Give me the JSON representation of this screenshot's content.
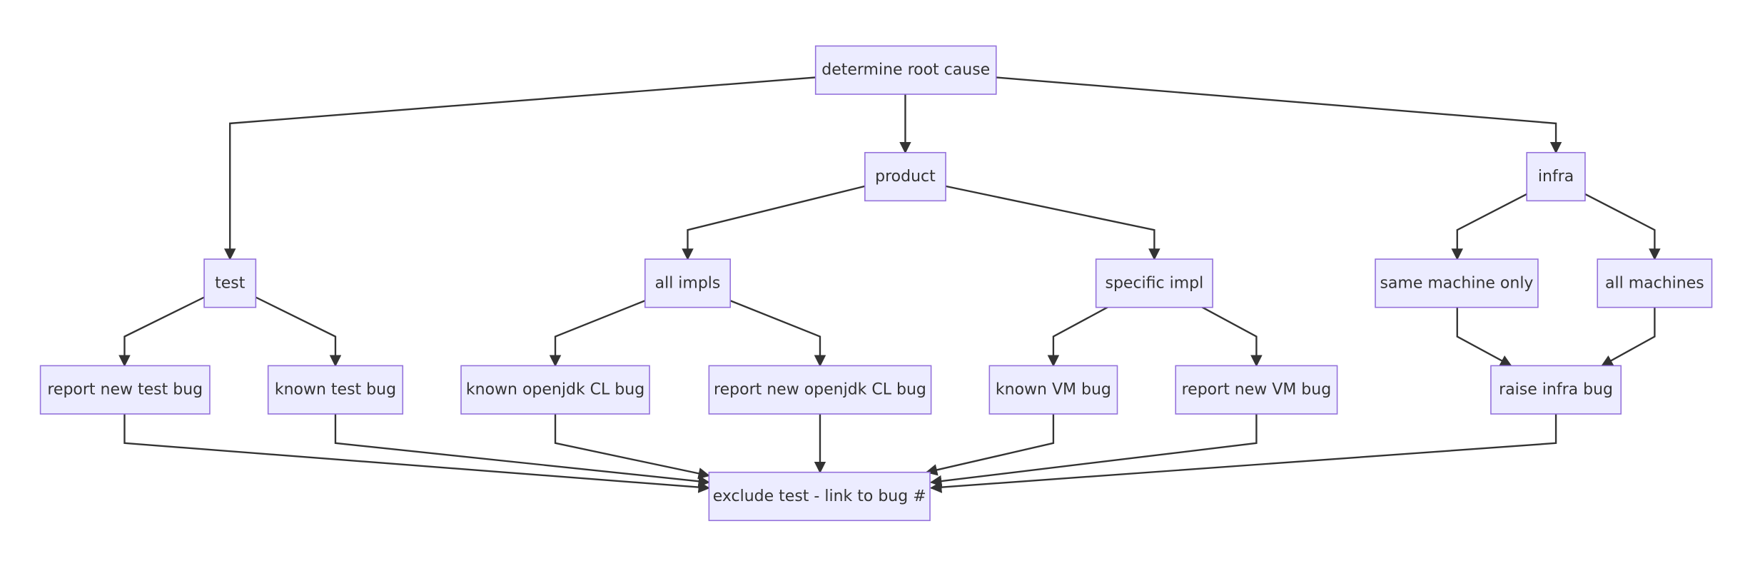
{
  "diagram": {
    "type": "flowchart",
    "direction": "top-down",
    "colors": {
      "node_fill": "#ECECFF",
      "node_border": "#9370DB",
      "edge": "#333333",
      "text": "#333333"
    },
    "nodes": {
      "root": "determine root cause",
      "test": "test",
      "product": "product",
      "infra": "infra",
      "all_impls": "all impls",
      "specific_impl": "specific impl",
      "same_machine": "same machine only",
      "all_machines": "all machines",
      "report_test_bug": "report new test bug",
      "known_test_bug": "known test bug",
      "known_openjdk": "known openjdk CL bug",
      "report_openjdk": "report new openjdk CL bug",
      "known_vm": "known VM bug",
      "report_vm": "report new VM bug",
      "raise_infra": "raise infra bug",
      "exclude": "exclude test - link to bug #"
    },
    "edges": [
      [
        "root",
        "test"
      ],
      [
        "root",
        "product"
      ],
      [
        "root",
        "infra"
      ],
      [
        "product",
        "all_impls"
      ],
      [
        "product",
        "specific_impl"
      ],
      [
        "infra",
        "same_machine"
      ],
      [
        "infra",
        "all_machines"
      ],
      [
        "test",
        "report_test_bug"
      ],
      [
        "test",
        "known_test_bug"
      ],
      [
        "all_impls",
        "known_openjdk"
      ],
      [
        "all_impls",
        "report_openjdk"
      ],
      [
        "specific_impl",
        "known_vm"
      ],
      [
        "specific_impl",
        "report_vm"
      ],
      [
        "same_machine",
        "raise_infra"
      ],
      [
        "all_machines",
        "raise_infra"
      ],
      [
        "report_test_bug",
        "exclude"
      ],
      [
        "known_test_bug",
        "exclude"
      ],
      [
        "known_openjdk",
        "exclude"
      ],
      [
        "report_openjdk",
        "exclude"
      ],
      [
        "known_vm",
        "exclude"
      ],
      [
        "report_vm",
        "exclude"
      ],
      [
        "raise_infra",
        "exclude"
      ]
    ]
  }
}
